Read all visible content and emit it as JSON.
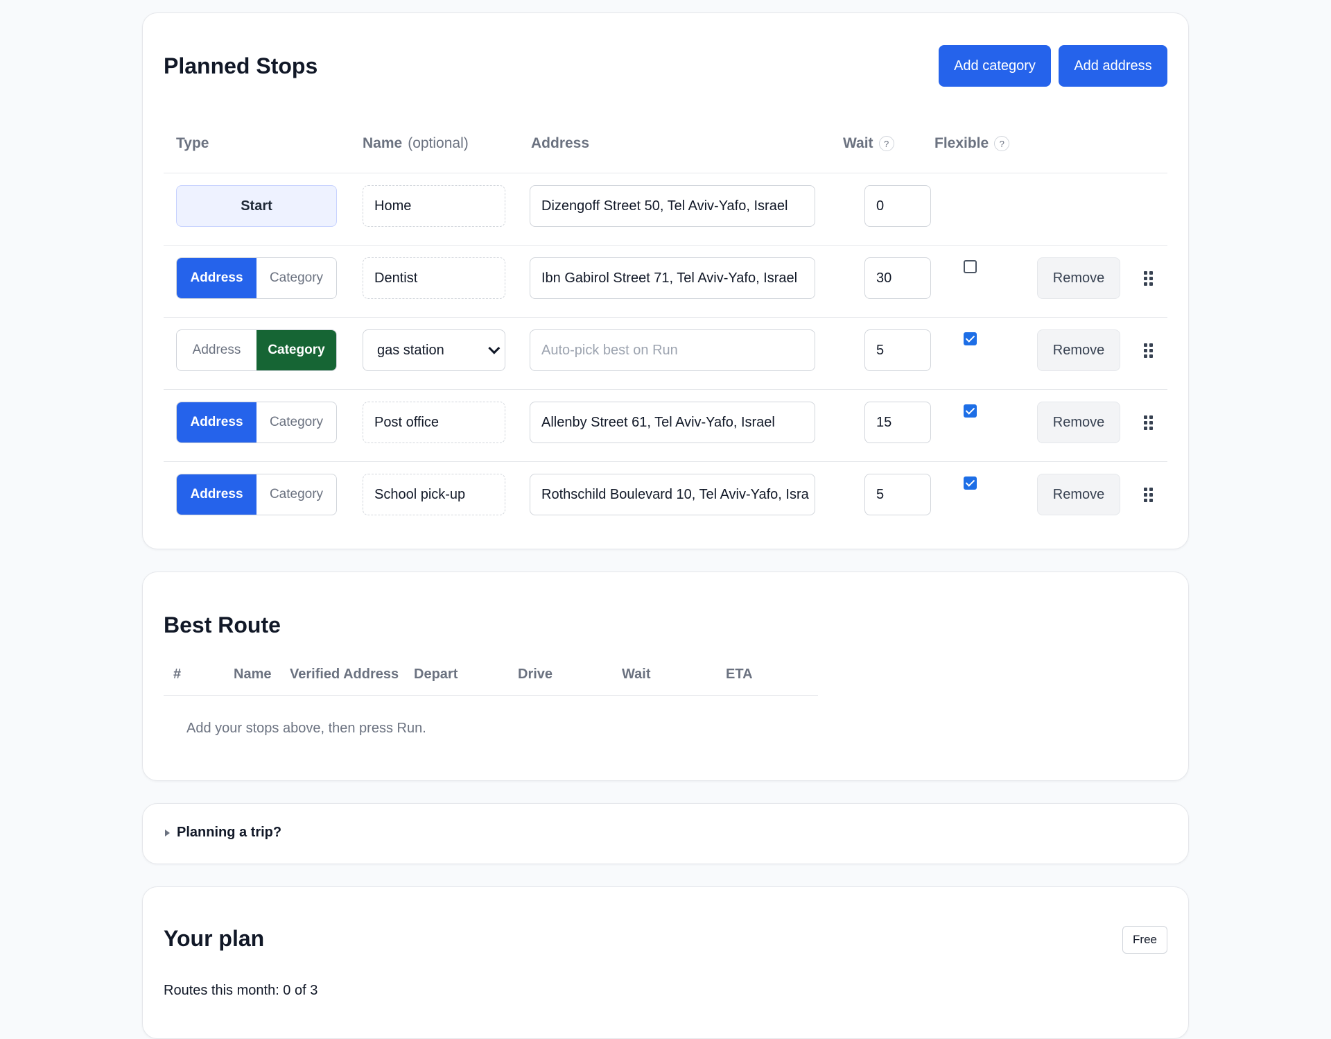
{
  "stops": {
    "title": "Planned Stops",
    "add_category_label": "Add category",
    "add_address_label": "Add address",
    "headers": {
      "type": "Type",
      "name": "Name",
      "name_optional": "(optional)",
      "address": "Address",
      "wait": "Wait",
      "flexible": "Flexible",
      "help": "?"
    },
    "start": {
      "type_label": "Start",
      "name": "Home",
      "address": "Dizengoff Street 50, Tel Aviv-Yafo, Israel",
      "wait": "0"
    },
    "toggle": {
      "address": "Address",
      "category": "Category"
    },
    "remove_label": "Remove",
    "rows": [
      {
        "mode": "address",
        "name": "Dentist",
        "address": "Ibn Gabirol Street 71, Tel Aviv-Yafo, Israel",
        "wait": "30",
        "flexible": false
      },
      {
        "mode": "category",
        "category_selected": "gas station",
        "address_placeholder": "Auto-pick best on Run",
        "wait": "5",
        "flexible": true
      },
      {
        "mode": "address",
        "name": "Post office",
        "address": "Allenby Street 61, Tel Aviv-Yafo, Israel",
        "wait": "15",
        "flexible": true
      },
      {
        "mode": "address",
        "name": "School pick-up",
        "address": "Rothschild Boulevard 10, Tel Aviv-Yafo, Isra",
        "wait": "5",
        "flexible": true
      }
    ]
  },
  "route": {
    "title": "Best Route",
    "columns": [
      "#",
      "Name",
      "Verified Address",
      "Depart",
      "Drive",
      "Wait",
      "ETA"
    ],
    "empty_text": "Add your stops above, then press Run."
  },
  "trip": {
    "summary": "Planning a trip?"
  },
  "plan": {
    "title": "Your plan",
    "badge": "Free",
    "usage": "Routes this month: 0 of 3"
  },
  "colors": {
    "primary": "#2563eb",
    "category_active": "#166534",
    "start_chip": "#eef2ff"
  }
}
